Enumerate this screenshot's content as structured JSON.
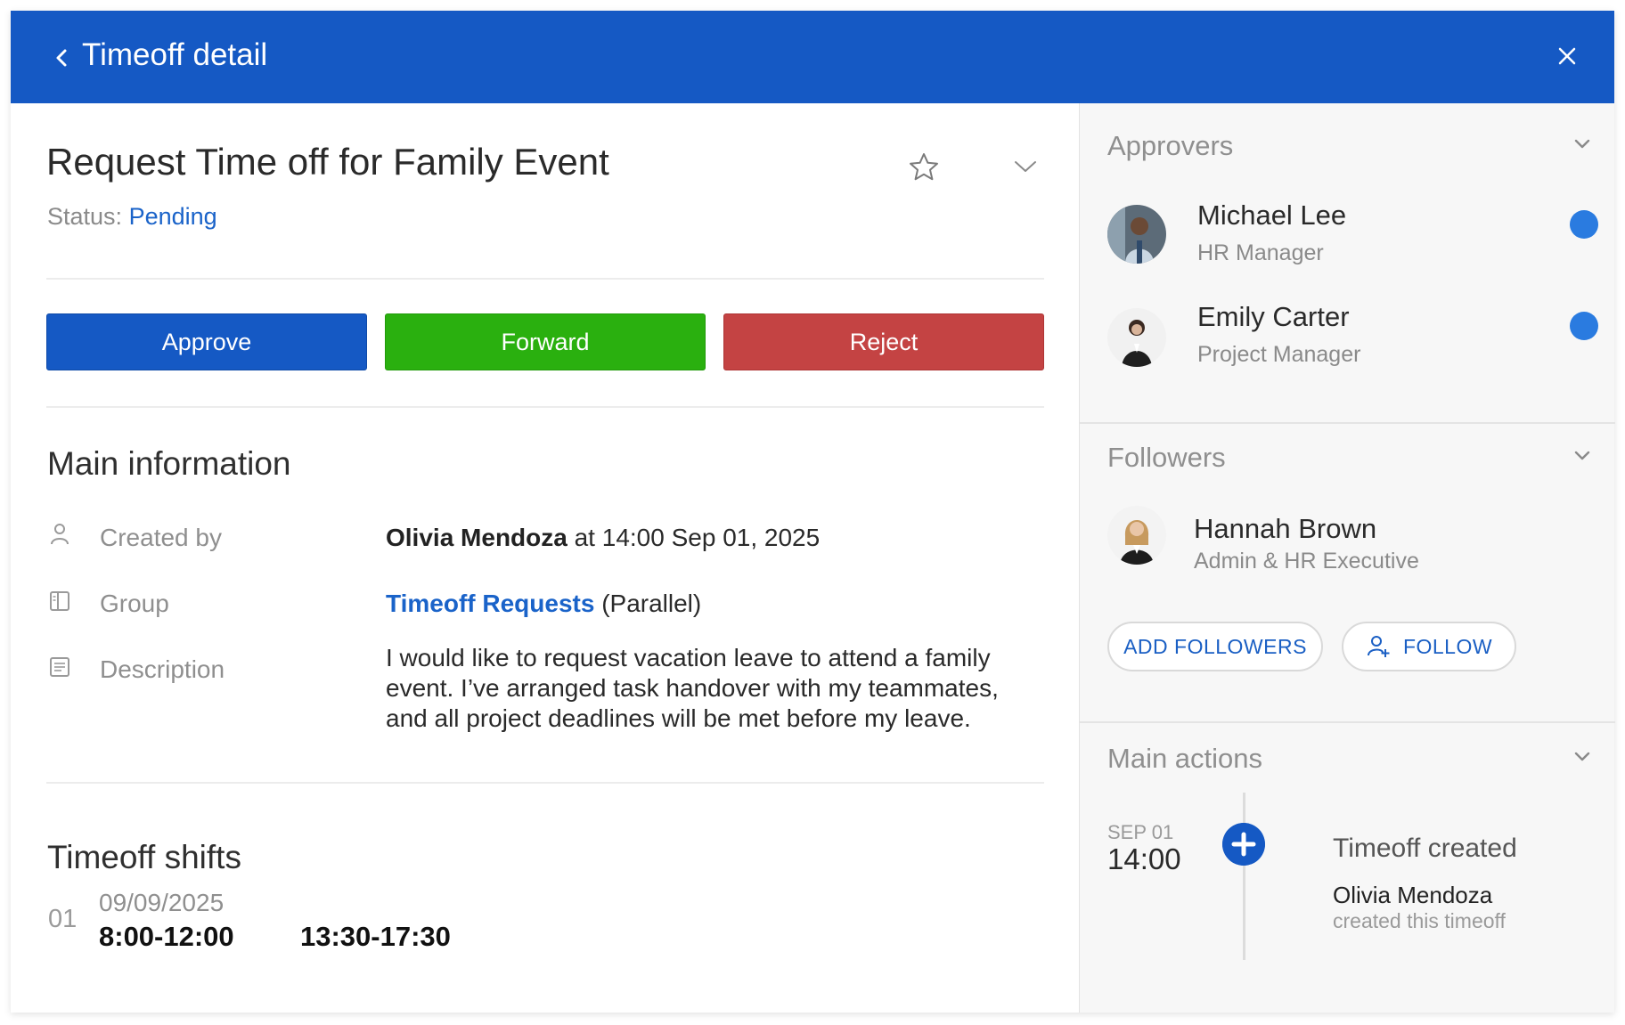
{
  "header": {
    "title": "Timeoff detail",
    "back_icon": "chevron-left-icon",
    "close_icon": "close-icon",
    "background": "#1559c4"
  },
  "request": {
    "title": "Request Time off for Family Event",
    "status_label": "Status:",
    "status_value": "Pending"
  },
  "actions": {
    "approve": "Approve",
    "forward": "Forward",
    "reject": "Reject",
    "colors": {
      "approve": "#1559c4",
      "forward": "#2ab00f",
      "reject": "#c44343"
    }
  },
  "main_info": {
    "title": "Main information",
    "created_by_label": "Created by",
    "created_by_name": "Olivia Mendoza",
    "created_by_time": "at 14:00 Sep 01, 2025",
    "group_label": "Group",
    "group_name": "Timeoff Requests",
    "group_mode": "(Parallel)",
    "description_label": "Description",
    "description": "I would like to request vacation leave to attend a family event. I’ve arranged task handover with my teammates, and all project deadlines will be met before my leave."
  },
  "shifts": {
    "title": "Timeoff shifts",
    "items": [
      {
        "index": "01",
        "date": "09/09/2025",
        "morning": "8:00-12:00",
        "afternoon": "13:30-17:30"
      }
    ]
  },
  "approvers": {
    "title": "Approvers",
    "people": [
      {
        "name": "Michael Lee",
        "role": "HR Manager"
      },
      {
        "name": "Emily Carter",
        "role": "Project Manager"
      }
    ]
  },
  "followers": {
    "title": "Followers",
    "people": [
      {
        "name": "Hannah Brown",
        "role": "Admin & HR Executive"
      }
    ],
    "add_label": "ADD FOLLOWERS",
    "follow_label": "FOLLOW"
  },
  "main_actions": {
    "title": "Main actions",
    "events": [
      {
        "date": "SEP 01",
        "time": "14:00",
        "title": "Timeoff created",
        "user": "Olivia Mendoza",
        "detail": "created this timeoff"
      }
    ]
  }
}
